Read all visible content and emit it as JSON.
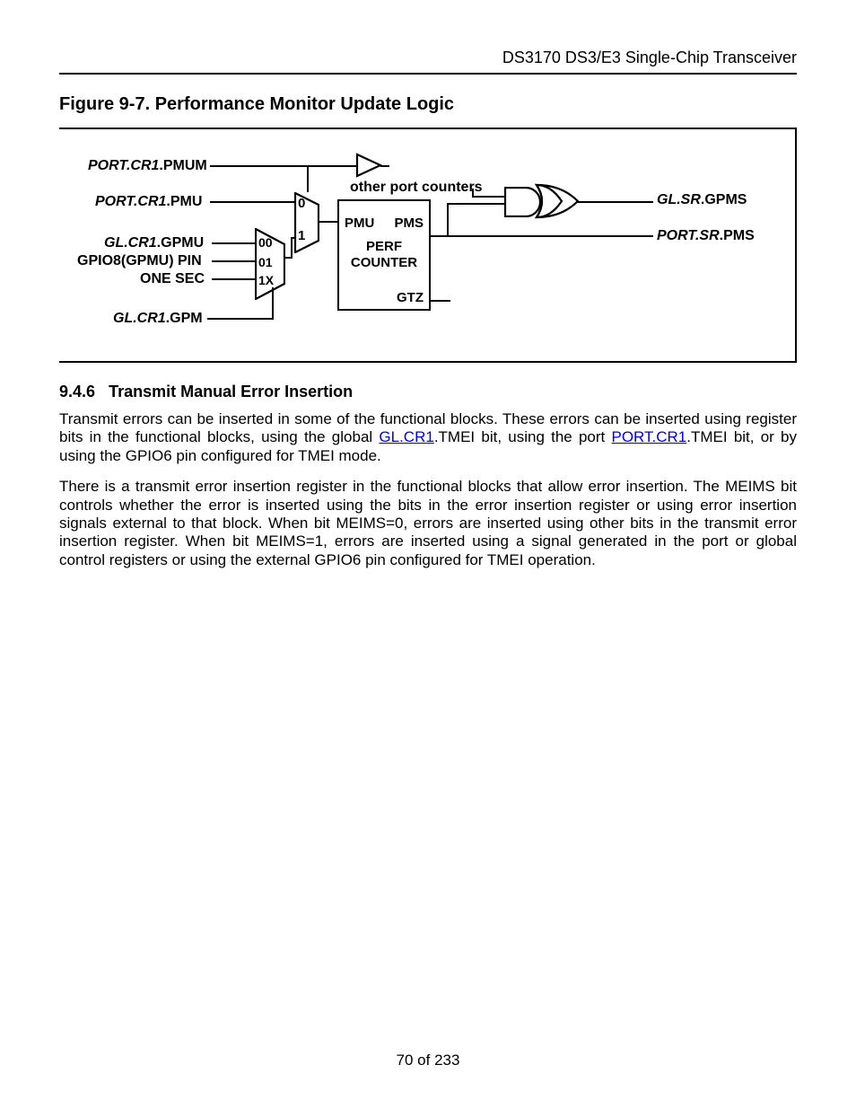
{
  "header": {
    "doc_title": "DS3170 DS3/E3 Single-Chip Transceiver"
  },
  "figure": {
    "caption": "Figure 9-7. Performance Monitor Update Logic",
    "labels": {
      "pmum": ".PMUM",
      "pmum_pre": "PORT.CR1",
      "pmu": ".PMU",
      "pmu_pre": "PORT.CR1",
      "gpmu": ".GPMU",
      "gpmu_pre": "GL.CR1",
      "gpio8": "GPIO8(GPMU) PIN",
      "onesec": "ONE SEC",
      "gpm": ".GPM",
      "gpm_pre": "GL.CR1",
      "other": "other port counters",
      "pc_pmu": "PMU",
      "pc_pms": "PMS",
      "pc_perf": "PERF",
      "pc_counter": "COUNTER",
      "pc_gtz": "GTZ",
      "gpms": ".GPMS",
      "gpms_pre": "GL.SR",
      "port_pms": ".PMS",
      "port_pms_pre": "PORT.SR",
      "mux2_0": "0",
      "mux2_1": "1",
      "mux4_00": "00",
      "mux4_01": "01",
      "mux4_1x": "1X"
    }
  },
  "section": {
    "num": "9.4.6",
    "title": "Transmit Manual Error Insertion",
    "p1a": "Transmit errors can be inserted in some of the functional blocks. These errors can be inserted using register bits in the functional blocks, using the global ",
    "link1": "GL.CR1",
    "p1b": ".TMEI bit, using the port ",
    "link2": "PORT.CR1",
    "p1c": ".TMEI bit, or by using the GPIO6 pin configured for TMEI mode.",
    "p2": "There is a transmit error insertion register in the functional blocks that allow error insertion. The MEIMS bit controls whether the error is inserted using the bits in the error insertion register or using error insertion signals external to that block. When bit MEIMS=0, errors are inserted using other bits in the transmit error insertion register. When bit MEIMS=1, errors are inserted using a signal generated in the port or global control registers or using the external GPIO6 pin configured for TMEI operation."
  },
  "footer": {
    "page": "70 of 233"
  }
}
